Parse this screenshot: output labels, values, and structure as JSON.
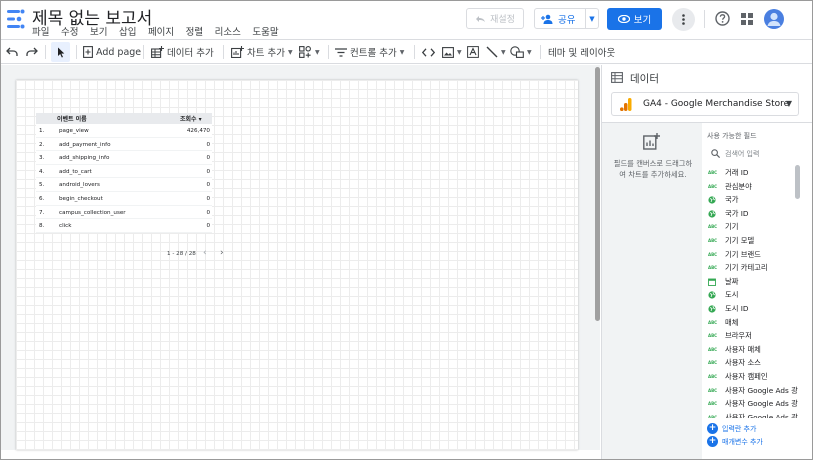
{
  "header": {
    "title": "제목 없는 보고서",
    "menu": [
      "파일",
      "수정",
      "보기",
      "삽입",
      "페이지",
      "정렬",
      "리소스",
      "도움말"
    ],
    "reset_label": "재설정",
    "share_label": "공유",
    "view_label": "보기"
  },
  "toolbar": {
    "add_page": "Add page",
    "add_data": "데이터 추가",
    "add_chart": "차트 추가",
    "add_control": "컨트롤 추가",
    "theme_layout": "테마 및 레이아웃"
  },
  "table": {
    "col_name": "이벤트 이름",
    "col_views": "조회수 ▾",
    "rows": [
      {
        "idx": "1.",
        "name": "page_view",
        "value": "426,470"
      },
      {
        "idx": "2.",
        "name": "add_payment_info",
        "value": "0"
      },
      {
        "idx": "3.",
        "name": "add_shipping_info",
        "value": "0"
      },
      {
        "idx": "4.",
        "name": "add_to_cart",
        "value": "0"
      },
      {
        "idx": "5.",
        "name": "android_lovers",
        "value": "0"
      },
      {
        "idx": "6.",
        "name": "begin_checkout",
        "value": "0"
      },
      {
        "idx": "7.",
        "name": "campus_collection_user",
        "value": "0"
      },
      {
        "idx": "8.",
        "name": "click",
        "value": "0"
      }
    ],
    "pager": "1 - 28 / 28"
  },
  "panel": {
    "title": "데이터",
    "data_source": "GA4 - Google Merchandise Store",
    "drop_hint": "필드를 캔버스로 드래그하여 차트를 추가하세요.",
    "fields_title": "사용 가능한 필드",
    "search_placeholder": "검색어 입력",
    "fields": [
      {
        "label": "거래 ID",
        "type": "abc"
      },
      {
        "label": "관심분야",
        "type": "abc"
      },
      {
        "label": "국가",
        "type": "geo"
      },
      {
        "label": "국가 ID",
        "type": "geo"
      },
      {
        "label": "기기",
        "type": "abc"
      },
      {
        "label": "기기 모델",
        "type": "abc"
      },
      {
        "label": "기기 브랜드",
        "type": "abc"
      },
      {
        "label": "기기 카테고리",
        "type": "abc"
      },
      {
        "label": "날짜",
        "type": "date"
      },
      {
        "label": "도시",
        "type": "geo"
      },
      {
        "label": "도시 ID",
        "type": "geo"
      },
      {
        "label": "매체",
        "type": "abc"
      },
      {
        "label": "브라우저",
        "type": "abc"
      },
      {
        "label": "사용자 매체",
        "type": "abc"
      },
      {
        "label": "사용자 소스",
        "type": "abc"
      },
      {
        "label": "사용자 캠페인",
        "type": "abc"
      },
      {
        "label": "사용자 Google Ads 광...",
        "type": "abc"
      },
      {
        "label": "사용자 Google Ads 광...",
        "type": "abc"
      },
      {
        "label": "사용자 Google Ads 광...",
        "type": "abc"
      }
    ],
    "add_dimension": "입력란 추가",
    "add_parameter": "매개변수 추가"
  },
  "colors": {
    "accent": "#1a73e8",
    "field_green": "#34a853"
  }
}
